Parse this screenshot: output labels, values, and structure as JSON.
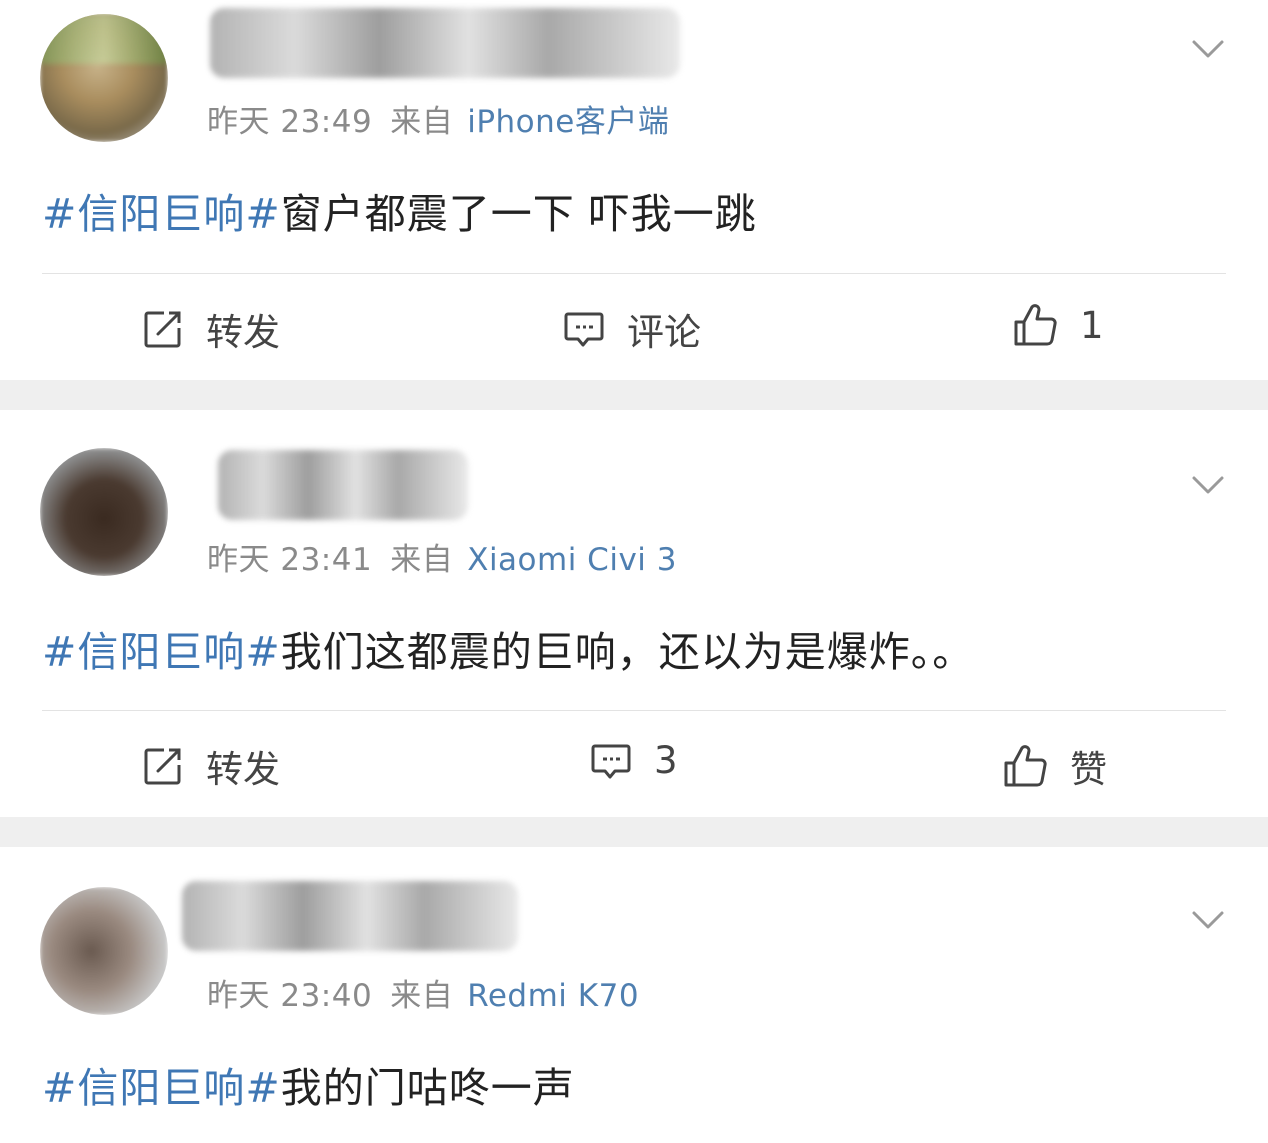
{
  "posts": [
    {
      "time": "昨天 23:49",
      "from_label": "来自",
      "source": "iPhone客户端",
      "topic": "#信阳巨响#",
      "text": "窗户都震了一下 吓我一跳",
      "actions": {
        "repost": "转发",
        "comment": "评论",
        "like": "1"
      }
    },
    {
      "time": "昨天 23:41",
      "from_label": "来自",
      "source": "Xiaomi Civi 3",
      "topic": "#信阳巨响#",
      "text": "我们这都震的巨响，还以为是爆炸。。",
      "actions": {
        "repost": "转发",
        "comment": "3",
        "like": "赞"
      }
    },
    {
      "time": "昨天 23:40",
      "from_label": "来自",
      "source": "Redmi K70",
      "topic": "#信阳巨响#",
      "text": "我的门咕咚一声"
    }
  ],
  "icons": {
    "repost": "repost-icon",
    "comment": "comment-icon",
    "like": "thumbs-up-icon",
    "menu": "chevron-down-icon"
  },
  "colors": {
    "topic": "#3f77b4",
    "source": "#4f7fb0",
    "separator": "#efefef"
  }
}
